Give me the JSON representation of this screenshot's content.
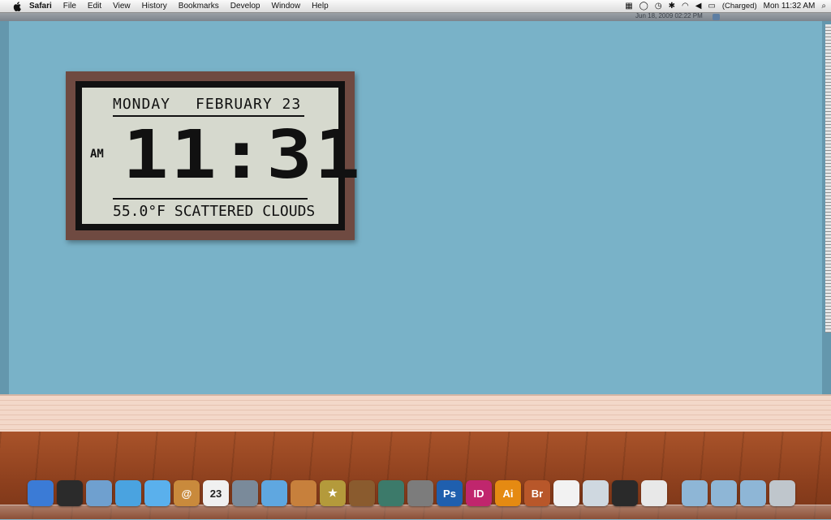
{
  "menubar": {
    "app_name": "Safari",
    "menus": [
      "File",
      "Edit",
      "View",
      "History",
      "Bookmarks",
      "Develop",
      "Window",
      "Help"
    ],
    "battery_status": "(Charged)",
    "clock": "Mon 11:32 AM"
  },
  "window_strip": {
    "date_text": "Jun 18, 2009 02:22 PM"
  },
  "clock_widget": {
    "day": "MONDAY",
    "date": "FEBRUARY 23",
    "ampm": "AM",
    "time": "11:31",
    "weather": "55.0°F SCATTERED CLOUDS"
  },
  "dock": {
    "apps": [
      {
        "icon": "finder-icon",
        "label": "",
        "color": "#3b7bd6"
      },
      {
        "icon": "dashboard-icon",
        "label": "",
        "color": "#2b2b2b"
      },
      {
        "icon": "mail-icon",
        "label": "",
        "color": "#6fa0cf"
      },
      {
        "icon": "safari-icon",
        "label": "",
        "color": "#4aa3e0"
      },
      {
        "icon": "ichat-icon",
        "label": "",
        "color": "#5ab0ec"
      },
      {
        "icon": "address-book-icon",
        "label": "@",
        "color": "#c98a3c"
      },
      {
        "icon": "ical-icon",
        "label": "23",
        "color": "#f0f0f0"
      },
      {
        "icon": "iphoto-icon",
        "label": "",
        "color": "#7a8a9a"
      },
      {
        "icon": "itunes-icon",
        "label": "",
        "color": "#5fa7e0"
      },
      {
        "icon": "image-capture-icon",
        "label": "",
        "color": "#c7803c"
      },
      {
        "icon": "imovie-icon",
        "label": "★",
        "color": "#b49a3b"
      },
      {
        "icon": "garageband-icon",
        "label": "",
        "color": "#8a5b2e"
      },
      {
        "icon": "time-machine-icon",
        "label": "",
        "color": "#3c7a6a"
      },
      {
        "icon": "system-preferences-icon",
        "label": "",
        "color": "#7c7c7c"
      },
      {
        "icon": "photoshop-icon",
        "label": "Ps",
        "color": "#1f5fae"
      },
      {
        "icon": "indesign-icon",
        "label": "ID",
        "color": "#c0266d"
      },
      {
        "icon": "illustrator-icon",
        "label": "Ai",
        "color": "#e58a12"
      },
      {
        "icon": "bridge-icon",
        "label": "Br",
        "color": "#b8572a"
      },
      {
        "icon": "acrobat-icon",
        "label": "",
        "color": "#f2f2f2"
      },
      {
        "icon": "preview-icon",
        "label": "",
        "color": "#cfd8e0"
      },
      {
        "icon": "activity-monitor-icon",
        "label": "",
        "color": "#2a2a2a"
      },
      {
        "icon": "script-editor-icon",
        "label": "",
        "color": "#e8e8e8"
      }
    ],
    "stacks": [
      {
        "icon": "downloads-stack-icon",
        "label": "",
        "color": "#8eb6d6"
      },
      {
        "icon": "documents-stack-icon",
        "label": "",
        "color": "#8eb6d6"
      },
      {
        "icon": "applications-stack-icon",
        "label": "",
        "color": "#8eb6d6"
      },
      {
        "icon": "trash-icon",
        "label": "",
        "color": "#bfc6cc"
      }
    ]
  }
}
